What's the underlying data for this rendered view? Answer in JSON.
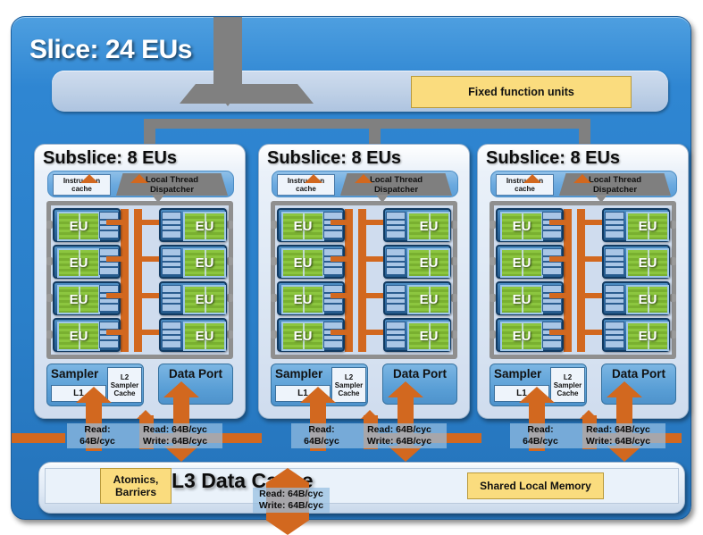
{
  "slice": {
    "title": "Slice: 24 EUs",
    "fixed_function_units": "Fixed function units"
  },
  "subslices": [
    {
      "title": "Subslice: 8 EUs",
      "instruction_cache": "Instruction\ncache",
      "instruction_cache_line1": "Instruction",
      "instruction_cache_line2": "cache",
      "local_thread_dispatcher_line1": "Local Thread",
      "local_thread_dispatcher_line2": "Dispatcher",
      "eu_label": "EU",
      "eu_count": 8,
      "sampler": "Sampler",
      "sampler_l1": "L1",
      "sampler_l2_line1": "L2",
      "sampler_l2_line2": "Sampler",
      "sampler_l2_line3": "Cache",
      "data_port": "Data Port",
      "sampler_bw_line1": "Read:",
      "sampler_bw_line2": "64B/cyc",
      "dataport_bw_line1": "Read: 64B/cyc",
      "dataport_bw_line2": "Write: 64B/cyc"
    },
    {
      "title": "Subslice: 8 EUs",
      "instruction_cache_line1": "Instruction",
      "instruction_cache_line2": "cache",
      "local_thread_dispatcher_line1": "Local Thread",
      "local_thread_dispatcher_line2": "Dispatcher",
      "eu_label": "EU",
      "eu_count": 8,
      "sampler": "Sampler",
      "sampler_l1": "L1",
      "sampler_l2_line1": "L2",
      "sampler_l2_line2": "Sampler",
      "sampler_l2_line3": "Cache",
      "data_port": "Data Port",
      "sampler_bw_line1": "Read:",
      "sampler_bw_line2": "64B/cyc",
      "dataport_bw_line1": "Read: 64B/cyc",
      "dataport_bw_line2": "Write: 64B/cyc"
    },
    {
      "title": "Subslice: 8 EUs",
      "instruction_cache_line1": "Instruction",
      "instruction_cache_line2": "cache",
      "local_thread_dispatcher_line1": "Local Thread",
      "local_thread_dispatcher_line2": "Dispatcher",
      "eu_label": "EU",
      "eu_count": 8,
      "sampler": "Sampler",
      "sampler_l1": "L1",
      "sampler_l2_line1": "L2",
      "sampler_l2_line2": "Sampler",
      "sampler_l2_line3": "Cache",
      "data_port": "Data Port",
      "sampler_bw_line1": "Read:",
      "sampler_bw_line2": "64B/cyc",
      "dataport_bw_line1": "Read: 64B/cyc",
      "dataport_bw_line2": "Write: 64B/cyc"
    }
  ],
  "l3": {
    "title": "L3 Data Cache",
    "atomics_line1": "Atomics,",
    "atomics_line2": "Barriers",
    "shared_local_memory": "Shared Local Memory",
    "external_bw_line1": "Read: 64B/cyc",
    "external_bw_line2": "Write: 64B/cyc"
  },
  "colors": {
    "slice_blue": "#2f86d2",
    "subslice_light": "#dfe9f5",
    "yellow": "#fadc7e",
    "orange_bus": "#d2681f",
    "grey_dispatch": "#808080",
    "eu_green": "#8cc63f",
    "eu_blue": "#2e6ea8"
  }
}
